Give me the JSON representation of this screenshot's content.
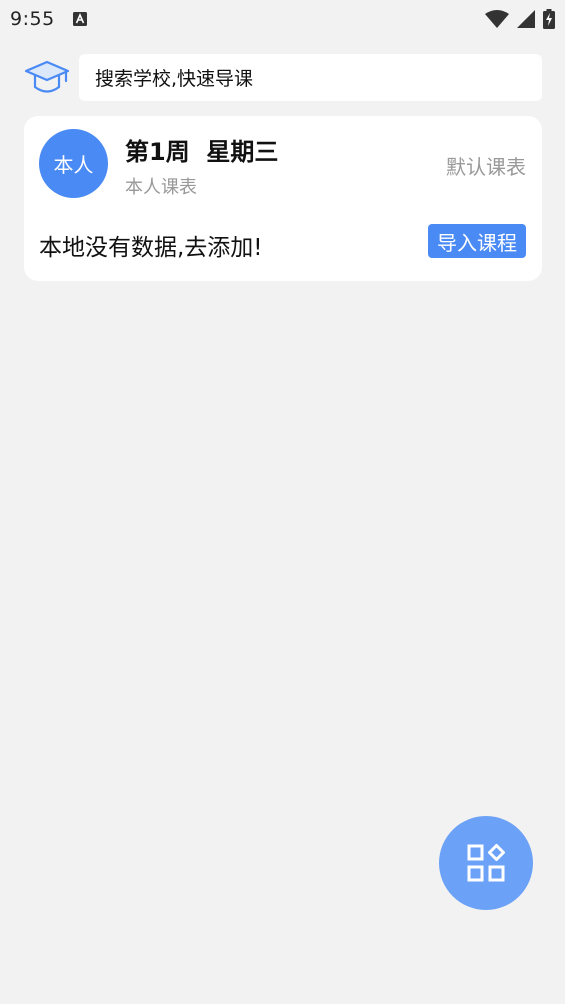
{
  "status_bar": {
    "time": "9:55",
    "icons": [
      "notification-a-icon",
      "wifi-icon",
      "signal-icon",
      "battery-charging-icon"
    ]
  },
  "search": {
    "placeholder": "搜索学校,快速导课",
    "icon": "graduation-cap-icon"
  },
  "card": {
    "avatar_text": "本人",
    "week_title": "第1周  星期三",
    "subtitle": "本人课表",
    "default_link": "默认课表",
    "empty_message": "本地没有数据,去添加!",
    "import_button": "导入课程"
  },
  "fab": {
    "icon": "apps-grid-icon"
  },
  "colors": {
    "background": "#f2f2f2",
    "accent": "#4a8af4",
    "fab": "#6ba1f7",
    "muted_text": "#999999"
  }
}
